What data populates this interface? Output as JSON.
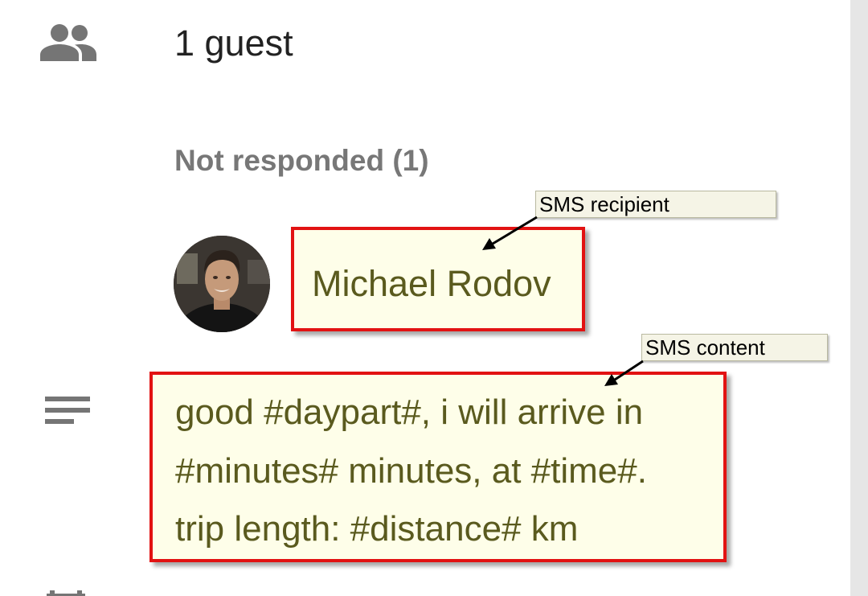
{
  "guests": {
    "icon": "people-icon",
    "count_label": "1 guest",
    "status_heading": "Not responded (1)",
    "list": [
      {
        "name": "Michael Rodov",
        "avatar": "avatar-photo"
      }
    ]
  },
  "description": {
    "icon": "notes-icon",
    "lines": [
      "good #daypart#, i will arrive in",
      "#minutes# minutes, at #time#.",
      "trip length: #distance# km"
    ]
  },
  "annotations": {
    "recipient_label": "SMS recipient",
    "content_label": "SMS content"
  },
  "colors": {
    "highlight_border": "#e21212",
    "highlight_fill": "#fefee9",
    "highlight_text": "#5a5a1e",
    "icon_gray": "#757575"
  }
}
